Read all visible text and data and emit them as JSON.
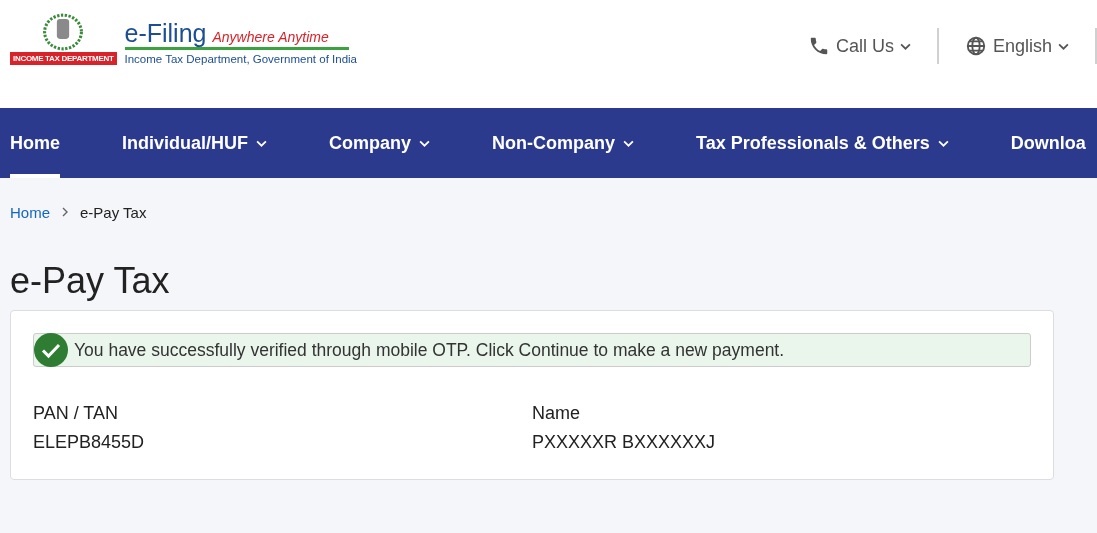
{
  "logo": {
    "ribbon": "INCOME TAX DEPARTMENT",
    "title": "e-Filing",
    "tagline": "Anywhere Anytime",
    "subtitle": "Income Tax Department, Government of India"
  },
  "top_links": [
    {
      "label": "Call Us"
    },
    {
      "label": "English"
    }
  ],
  "nav": [
    {
      "label": "Home",
      "selected": true,
      "dropdown": false
    },
    {
      "label": "Individual/HUF",
      "selected": false,
      "dropdown": true
    },
    {
      "label": "Company",
      "selected": false,
      "dropdown": true
    },
    {
      "label": "Non-Company",
      "selected": false,
      "dropdown": true
    },
    {
      "label": "Tax Professionals & Others",
      "selected": false,
      "dropdown": true
    },
    {
      "label": "Downloa",
      "selected": false,
      "dropdown": false
    }
  ],
  "breadcrumb": [
    {
      "label": "Home",
      "link": true
    },
    {
      "label": "e-Pay Tax",
      "link": false
    }
  ],
  "page_title": "e-Pay Tax",
  "alert": {
    "kind": "success",
    "message": "You have successfully verified through mobile OTP. Click Continue to make a new payment."
  },
  "fields": [
    {
      "label": "PAN / TAN",
      "value": "ELEPB8455D"
    },
    {
      "label": "Name",
      "value": "PXXXXXR BXXXXXXJ"
    }
  ]
}
